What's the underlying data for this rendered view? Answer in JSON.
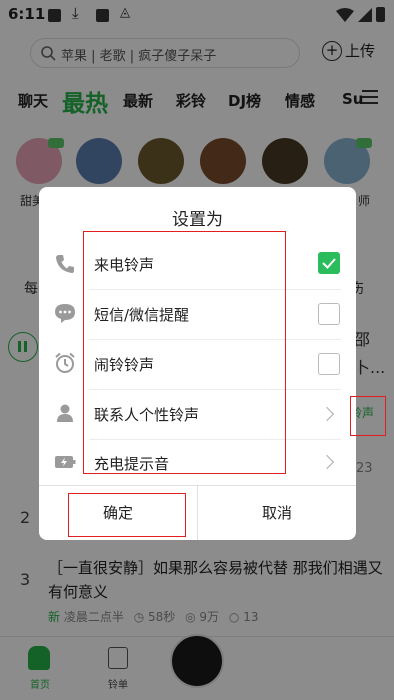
{
  "status_bar": {
    "time": "6:11"
  },
  "search": {
    "placeholder": "苹果 | 老歌 | 疯子傻子呆子",
    "upload_label": "上传"
  },
  "tabs": [
    {
      "label": "聊天"
    },
    {
      "label": "最热"
    },
    {
      "label": "最新"
    },
    {
      "label": "彩铃"
    },
    {
      "label": "DJ榜"
    },
    {
      "label": "情感"
    },
    {
      "label": "Su"
    }
  ],
  "avatar_labels": {
    "first": "甜美",
    "last": "师"
  },
  "category_labels": {
    "left": "每",
    "right": "伤"
  },
  "background_list": {
    "item1_side_text_1": "邵",
    "item1_side_text_2": "卜...",
    "item1_ringtone_button": "铃声",
    "item1_count": "23",
    "item2_num": "2",
    "item3_num": "3",
    "item3_title": "［一直很安静］如果那么容易被代替 那我们相遇又有何意义",
    "item3_tag": "新",
    "item3_author": "凌晨二点半",
    "item3_duration": "58秒",
    "item3_plays": "9万",
    "item3_comments": "13"
  },
  "bottom_nav": {
    "home": "首页",
    "ringtone_list": "铃单"
  },
  "dialog": {
    "title": "设置为",
    "options": [
      {
        "label": "来电铃声",
        "icon": "phone-icon",
        "checked": true
      },
      {
        "label": "短信/微信提醒",
        "icon": "message-icon",
        "checked": false
      },
      {
        "label": "闹铃铃声",
        "icon": "alarm-icon",
        "checked": false
      },
      {
        "label": "联系人个性铃声",
        "icon": "contact-icon"
      },
      {
        "label": "充电提示音",
        "icon": "battery-charge-icon"
      }
    ],
    "confirm_label": "确定",
    "cancel_label": "取消"
  },
  "colors": {
    "accent": "#27b24a",
    "check": "#2bbd5b",
    "annotation": "#e02020"
  }
}
